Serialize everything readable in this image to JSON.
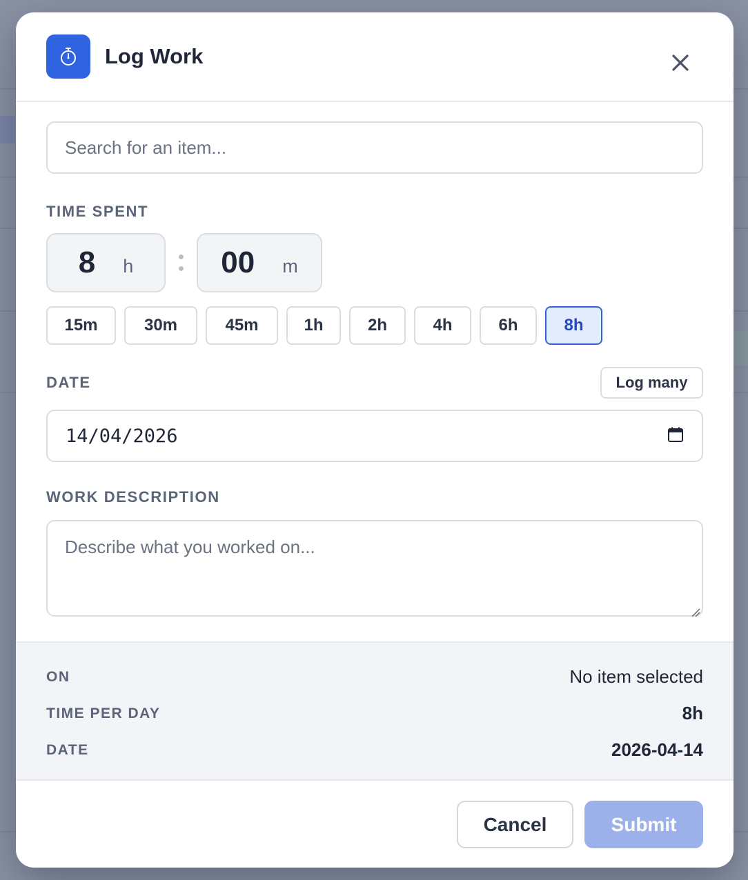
{
  "modal": {
    "title": "Log Work",
    "search_placeholder": "Search for an item...",
    "time_spent_label": "TIME SPENT",
    "hours_value": "8",
    "hours_unit": "h",
    "minutes_value": "00",
    "minutes_unit": "m",
    "presets": [
      {
        "label": "15m",
        "active": false
      },
      {
        "label": "30m",
        "active": false
      },
      {
        "label": "45m",
        "active": false
      },
      {
        "label": "1h",
        "active": false
      },
      {
        "label": "2h",
        "active": false
      },
      {
        "label": "4h",
        "active": false
      },
      {
        "label": "6h",
        "active": false
      },
      {
        "label": "8h",
        "active": true
      }
    ],
    "date_label": "DATE",
    "log_many_label": "Log many",
    "date_value": "14/04/2026",
    "description_label": "WORK DESCRIPTION",
    "description_placeholder": "Describe what you worked on..."
  },
  "summary": {
    "on_label": "ON",
    "on_value": "No item selected",
    "time_label": "TIME PER DAY",
    "time_value": "8h",
    "date_label": "DATE",
    "date_value": "2026-04-14"
  },
  "footer": {
    "cancel_label": "Cancel",
    "submit_label": "Submit"
  },
  "colors": {
    "accent": "#2f63e0",
    "submit_disabled": "#9cb1ea",
    "active_preset_bg": "#e3ecfd"
  },
  "icons": {
    "header": "stopwatch-icon",
    "close": "close-icon",
    "calendar": "calendar-icon"
  }
}
